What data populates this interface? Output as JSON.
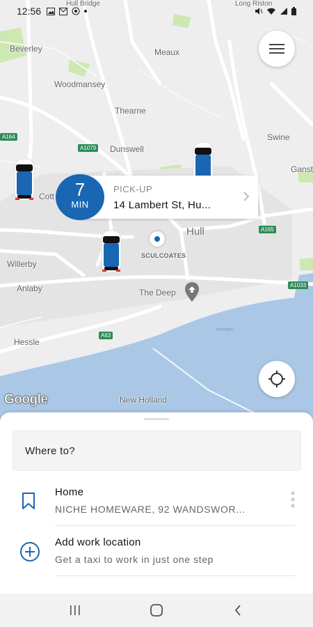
{
  "status_bar": {
    "time": "12:56"
  },
  "map": {
    "places": {
      "beverley": "Beverley",
      "woodmansey": "Woodmansey",
      "meaux": "Meaux",
      "thearne": "Thearne",
      "swine": "Swine",
      "ganstead": "Ganst",
      "dunswell": "Dunswell",
      "cottingham": "Cott",
      "hull": "Hull",
      "sculcoates": "SCULCOATES",
      "willerby": "Willerby",
      "anlaby": "Anlaby",
      "the_deep": "The Deep",
      "hessle": "Hessle",
      "new_holland": "New Holland",
      "humber": "Humber",
      "hull_bridge": "Hull Bridge",
      "long_riston": "Long Riston"
    },
    "road_shields": {
      "a164": "A164",
      "a1079": "A1079",
      "a165": "A165",
      "a63": "A63",
      "a1033": "A1033"
    },
    "attribution": "Google"
  },
  "pickup": {
    "eta_value": "7",
    "eta_unit": "MIN",
    "label": "PICK-UP",
    "address": "14 Lambert St, Hu..."
  },
  "sheet": {
    "search_placeholder": "Where to?",
    "saved": [
      {
        "title": "Home",
        "subtitle": "NICHE HOMEWARE, 92 WANDSWOR...",
        "icon": "bookmark-icon"
      },
      {
        "title": "Add work location",
        "subtitle": "Get a taxi to work in just one step",
        "icon": "add-circle-icon"
      }
    ]
  },
  "colors": {
    "brand": "#1a66b3",
    "water": "#aac8e6",
    "park": "#cde8b0",
    "map_bg": "#eeeeee"
  }
}
